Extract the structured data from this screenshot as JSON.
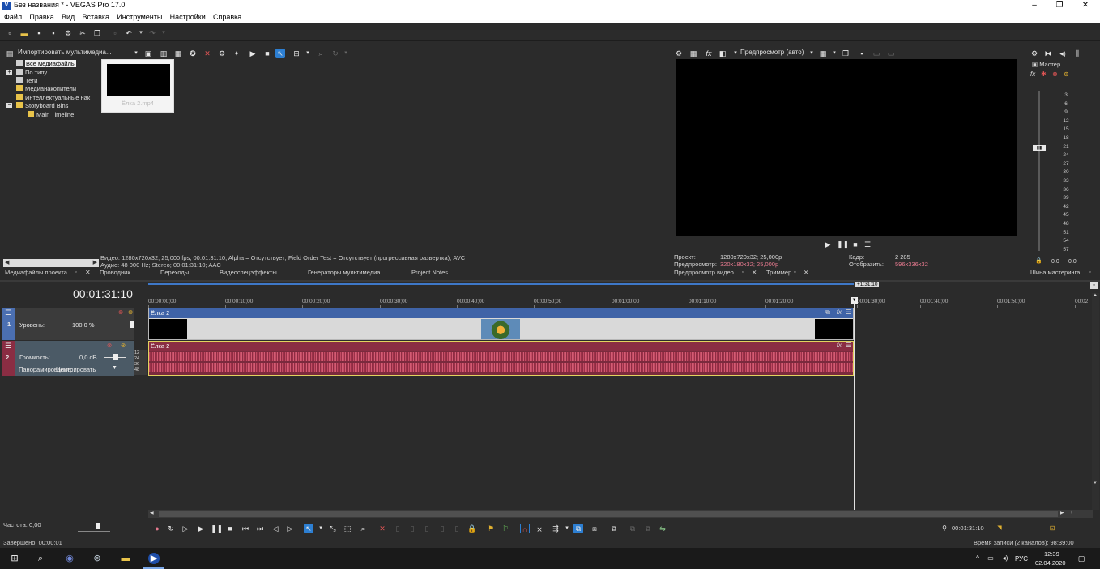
{
  "window": {
    "title": "Без названия * - VEGAS Pro 17.0",
    "app_icon": "V"
  },
  "window_controls": {
    "minimize": "–",
    "maximize": "❐",
    "close": "✕"
  },
  "menu": [
    "Файл",
    "Правка",
    "Вид",
    "Вставка",
    "Инструменты",
    "Настройки",
    "Справка"
  ],
  "media_panel": {
    "import_label": "Импортировать мультимедиа...",
    "tree": [
      {
        "label": "Все медиафайлы",
        "selected": true
      },
      {
        "label": "По типу"
      },
      {
        "label": "Теги"
      },
      {
        "label": "Медианакопители"
      },
      {
        "label": "Интеллектуальные нак"
      },
      {
        "label": "Storyboard Bins"
      },
      {
        "label": "Main Timeline"
      }
    ],
    "thumbnail_label": "Ёлка 2.mp4",
    "info_line1": "Видео: 1280x720x32; 25,000 fps; 00:01:31:10; Alpha = Отсутствует; Field Order Test = Отсутствует (прогрессивная развертка); AVC",
    "info_line2": "Аудио: 48 000 Hz; Stereo; 00:01:31:10; AAC",
    "tabs": [
      "Медиафайлы проекта",
      "Проводник",
      "Переходы",
      "Видеоспецэффекты",
      "Генераторы мультимедиа",
      "Project Notes"
    ]
  },
  "preview_panel": {
    "mode_label": "Предпросмотр (авто)",
    "project_label": "Проект:",
    "project_value": "1280x720x32; 25,000p",
    "preview_label": "Предпросмотр:",
    "preview_value": "320x180x32; 25,000p",
    "frame_label": "Кадр:",
    "frame_value": "2 285",
    "display_label": "Отобразить:",
    "display_value": "596x336x32",
    "tabs": [
      "Предпросмотр видео",
      "Триммер"
    ]
  },
  "master_panel": {
    "label": "Мастер",
    "scale": [
      "3",
      "6",
      "9",
      "12",
      "15",
      "18",
      "21",
      "24",
      "27",
      "30",
      "33",
      "36",
      "39",
      "42",
      "45",
      "48",
      "51",
      "54",
      "57"
    ],
    "value_left": "0.0",
    "value_right": "0.0",
    "tab": "Шина мастеринга"
  },
  "timeline": {
    "timecode": "00:01:31:10",
    "end_marker": "+1:31:10",
    "ruler": [
      "00:00:00;00",
      "00:00:10;00",
      "00:00:20;00",
      "00:00:30;00",
      "00:00:40;00",
      "00:00:50;00",
      "00:01:00;00",
      "00:01:10;00",
      "00:01:20;00",
      "00:01:30;00",
      "00:01:40;00",
      "00:01:50;00",
      "00:02"
    ],
    "track1": {
      "number": "1",
      "level_label": "Уровень:",
      "level_value": "100,0 %",
      "clip_name": "Ёлка 2"
    },
    "track2": {
      "number": "2",
      "volume_label": "Громкость:",
      "volume_value": "0,0 dB",
      "pan_label": "Панорамирование:",
      "pan_value": "Центрировать",
      "db_scale": [
        "12",
        "24",
        "36",
        "48"
      ],
      "clip_name": "Ёлка 2"
    },
    "rate_label": "Частота: 0,00",
    "cursor_time": "00:01:31:10"
  },
  "status": {
    "done": "Завершено: 00:00:01",
    "record_time": "Время записи (2 каналов): 98:39:00"
  },
  "taskbar": {
    "language": "РУС",
    "time": "12:39",
    "date": "02.04.2020"
  }
}
